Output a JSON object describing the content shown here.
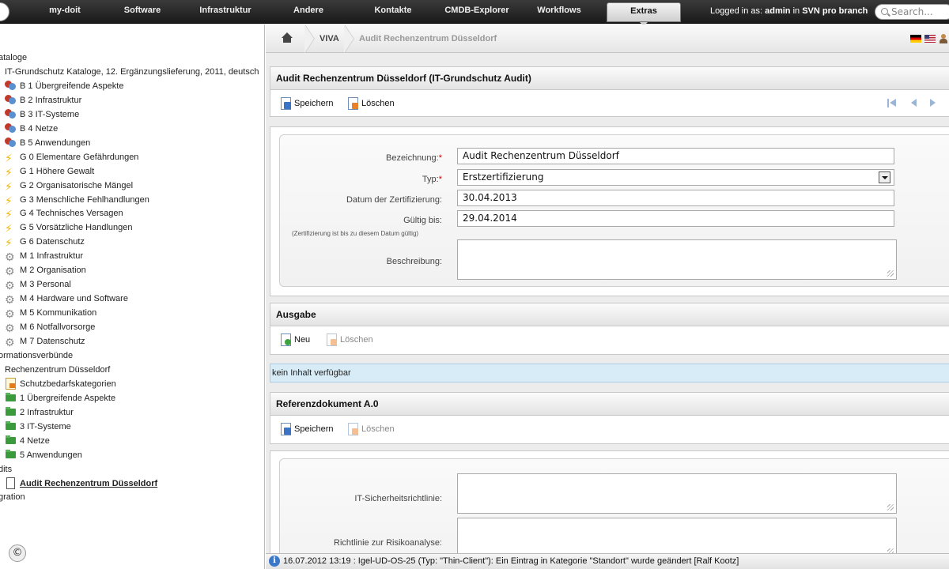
{
  "nav": {
    "items": [
      "my-doit",
      "Software",
      "Infrastruktur",
      "Andere",
      "Kontakte",
      "CMDB-Explorer",
      "Workflows",
      "Extras"
    ],
    "active": "Extras",
    "login_prefix": "Logged in as:",
    "login_user": "admin",
    "login_mid": "in",
    "login_db": "SVN pro branch",
    "search_placeholder": "Search..."
  },
  "tree": {
    "items": [
      {
        "label": "ataloge",
        "icon": "none"
      },
      {
        "label": "IT-Grundschutz Kataloge, 12. Ergänzungslieferung, 2011, deutsch",
        "icon": "none"
      },
      {
        "label": "B 1 Übergreifende Aspekte",
        "icon": "baustein-icon"
      },
      {
        "label": "B 2 Infrastruktur",
        "icon": "baustein-icon"
      },
      {
        "label": "B 3 IT-Systeme",
        "icon": "baustein-icon"
      },
      {
        "label": "B 4 Netze",
        "icon": "baustein-icon"
      },
      {
        "label": "B 5 Anwendungen",
        "icon": "baustein-icon"
      },
      {
        "label": "G 0 Elementare Gefährdungen",
        "icon": "lightning-icon"
      },
      {
        "label": "G 1 Höhere Gewalt",
        "icon": "lightning-icon"
      },
      {
        "label": "G 2 Organisatorische Mängel",
        "icon": "lightning-icon"
      },
      {
        "label": "G 3 Menschliche Fehlhandlungen",
        "icon": "lightning-icon"
      },
      {
        "label": "G 4 Technisches Versagen",
        "icon": "lightning-icon"
      },
      {
        "label": "G 5 Vorsätzliche Handlungen",
        "icon": "lightning-icon"
      },
      {
        "label": "G 6 Datenschutz",
        "icon": "lightning-icon"
      },
      {
        "label": "M 1 Infrastruktur",
        "icon": "gear-icon"
      },
      {
        "label": "M 2 Organisation",
        "icon": "gear-icon"
      },
      {
        "label": "M 3 Personal",
        "icon": "gear-icon"
      },
      {
        "label": "M 4 Hardware und Software",
        "icon": "gear-icon"
      },
      {
        "label": "M 5 Kommunikation",
        "icon": "gear-icon"
      },
      {
        "label": "M 6 Notfallvorsorge",
        "icon": "gear-icon"
      },
      {
        "label": "M 7 Datenschutz",
        "icon": "gear-icon"
      },
      {
        "label": "ormationsverbünde",
        "icon": "none"
      },
      {
        "label": "Rechenzentrum Düsseldorf",
        "icon": "none"
      },
      {
        "label": "Schutzbedarfskategorien",
        "icon": "category-icon"
      },
      {
        "label": "1 Übergreifende Aspekte",
        "icon": "folder-icon"
      },
      {
        "label": "2 Infrastruktur",
        "icon": "folder-icon"
      },
      {
        "label": "3 IT-Systeme",
        "icon": "folder-icon"
      },
      {
        "label": "4 Netze",
        "icon": "folder-icon"
      },
      {
        "label": "5 Anwendungen",
        "icon": "folder-icon"
      },
      {
        "label": "dits",
        "icon": "none"
      },
      {
        "label": "Audit Rechenzentrum Düsseldorf",
        "icon": "document-icon"
      },
      {
        "label": "gration",
        "icon": "none"
      }
    ],
    "copyright_symbol": "©"
  },
  "breadcrumb": {
    "root": "VIVA",
    "current": "Audit Rechenzentrum Düsseldorf"
  },
  "audit_section": {
    "title": "Audit Rechenzentrum Düsseldorf (IT-Grundschutz Audit)",
    "save_label": "Speichern",
    "delete_label": "Löschen",
    "fields": {
      "bezeichnung_label": "Bezeichnung:",
      "bezeichnung_value": "Audit Rechenzentrum Düsseldorf",
      "typ_label": "Typ:",
      "typ_value": "Erstzertifizierung",
      "datum_label": "Datum der Zertifizierung:",
      "datum_value": "30.04.2013",
      "gueltig_label": "Gültig bis:",
      "gueltig_value": "29.04.2014",
      "gueltig_note": "(Zertifizierung ist bis zu diesem Datum gültig)",
      "beschreibung_label": "Beschreibung:",
      "beschreibung_value": ""
    },
    "required_marker": "*"
  },
  "ausgabe_section": {
    "title": "Ausgabe",
    "new_label": "Neu",
    "delete_label": "Löschen",
    "empty_text": "kein Inhalt verfügbar"
  },
  "referenz_section": {
    "title": "Referenzdokument A.0",
    "save_label": "Speichern",
    "delete_label": "Löschen",
    "fields": {
      "richtlinie_label": "IT-Sicherheitsrichtlinie:",
      "risiko_label": "Richtlinie zur Risikoanalyse:"
    }
  },
  "statusbar": {
    "icon": "i",
    "text": "16.07.2012 13:19 : Igel-UD-OS-25 (Typ: \"Thin-Client\"): Ein Eintrag in Kategorie \"Standort\" wurde geändert [Ralf Kootz]"
  }
}
